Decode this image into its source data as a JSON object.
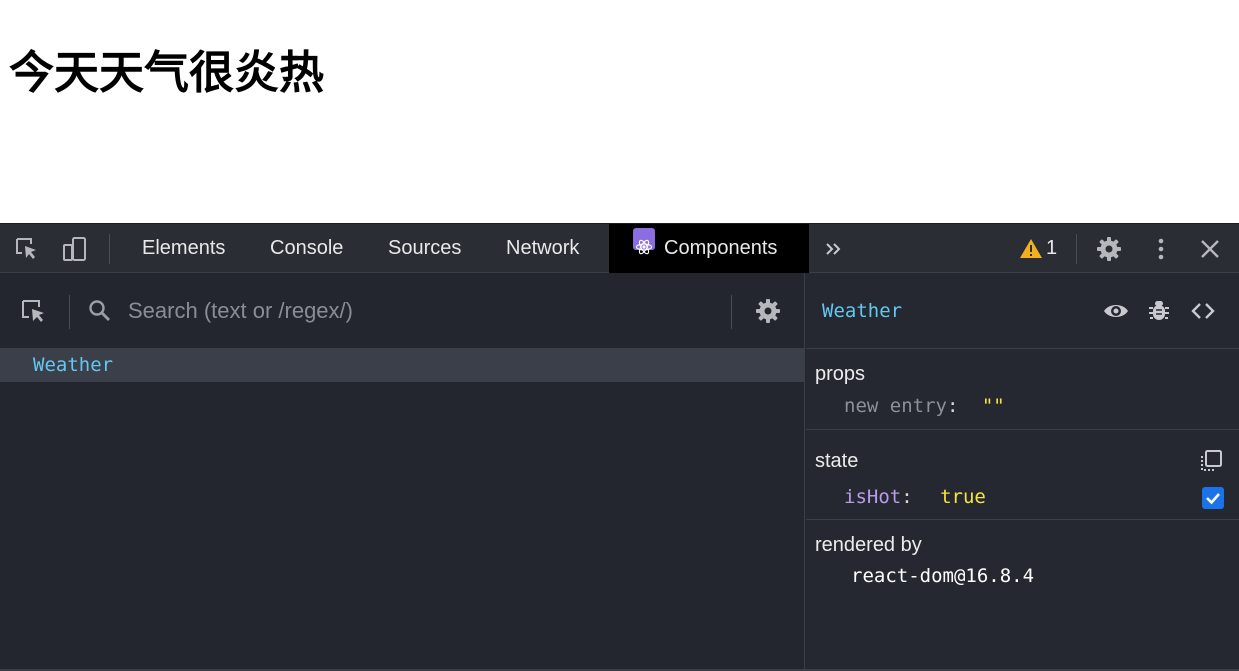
{
  "page": {
    "heading": "今天天气很炎热"
  },
  "devtools": {
    "tabs": [
      {
        "label": "Elements"
      },
      {
        "label": "Console"
      },
      {
        "label": "Sources"
      },
      {
        "label": "Network"
      },
      {
        "label": "Components"
      }
    ],
    "more_tabs_icon": "chevron-double-right",
    "warning_count": "1",
    "colors": {
      "active_tab_bg": "#000000",
      "component_name": "#63c7f0",
      "value_yellow": "#f5e63b",
      "state_key": "#b79ce9",
      "checkbox": "#1a73e8"
    }
  },
  "components": {
    "search": {
      "placeholder": "Search (text or /regex/)",
      "value": ""
    },
    "tree": [
      {
        "name": "Weather",
        "selected": true
      }
    ]
  },
  "inspector": {
    "component_name": "Weather",
    "props": {
      "title": "props",
      "items": [
        {
          "key": "new entry",
          "value": "\"\""
        }
      ]
    },
    "state": {
      "title": "state",
      "items": [
        {
          "key": "isHot",
          "value": "true",
          "checked": true
        }
      ]
    },
    "rendered_by": {
      "title": "rendered by",
      "value": "react-dom@16.8.4"
    }
  }
}
